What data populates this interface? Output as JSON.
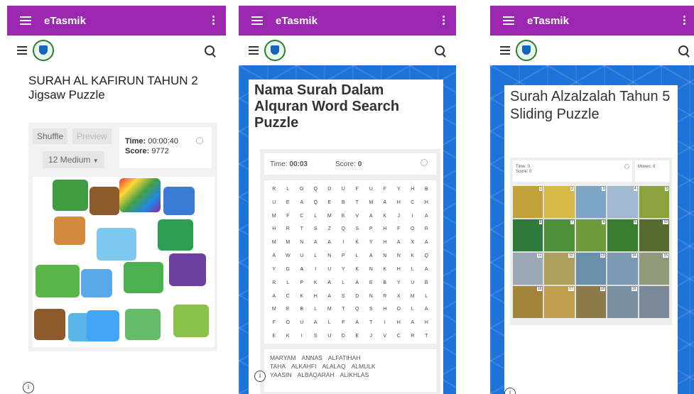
{
  "phones": [
    {
      "app_title": "eTasmik",
      "puzzle_title_line1": "SURAH AL KAFIRUN TAHUN 2",
      "puzzle_title_line2": "Jigsaw Puzzle",
      "shuffle_label": "Shuffle",
      "preview_label": "Preview",
      "difficulty_value": "12 Medium",
      "time_label": "Time:",
      "time_value": "00:00:40",
      "score_label": "Score:",
      "score_value": "9772"
    },
    {
      "app_title": "eTasmik",
      "puzzle_title": "Nama Surah Dalam Alquran Word Search Puzzle",
      "time_label": "Time:",
      "time_value": "00:03",
      "score_label": "Score:",
      "score_value": "0",
      "grid": [
        [
          "R",
          "L",
          "G",
          "Q",
          "D",
          "U",
          "F",
          "U",
          "F",
          "Y",
          "H",
          "B"
        ],
        [
          "U",
          "E",
          "A",
          "Q",
          "E",
          "B",
          "T",
          "M",
          "A",
          "H",
          "C",
          "H"
        ],
        [
          "M",
          "F",
          "C",
          "L",
          "M",
          "E",
          "V",
          "A",
          "K",
          "J",
          "I",
          "A"
        ],
        [
          "H",
          "R",
          "T",
          "S",
          "Z",
          "Q",
          "S",
          "P",
          "H",
          "F",
          "O",
          "R"
        ],
        [
          "M",
          "M",
          "N",
          "A",
          "A",
          "I",
          "K",
          "Y",
          "H",
          "A",
          "X",
          "A"
        ],
        [
          "A",
          "W",
          "U",
          "L",
          "N",
          "P",
          "L",
          "A",
          "N",
          "N",
          "K",
          "Q"
        ],
        [
          "Y",
          "G",
          "A",
          "I",
          "U",
          "Y",
          "K",
          "N",
          "K",
          "H",
          "L",
          "A"
        ],
        [
          "R",
          "L",
          "P",
          "K",
          "A",
          "L",
          "A",
          "E",
          "B",
          "Y",
          "U",
          "B"
        ],
        [
          "A",
          "C",
          "K",
          "H",
          "A",
          "S",
          "D",
          "N",
          "R",
          "X",
          "M",
          "L"
        ],
        [
          "M",
          "E",
          "B",
          "L",
          "M",
          "T",
          "Q",
          "S",
          "H",
          "O",
          "L",
          "A"
        ],
        [
          "F",
          "O",
          "U",
          "A",
          "L",
          "F",
          "A",
          "T",
          "I",
          "H",
          "A",
          "H"
        ],
        [
          "E",
          "K",
          "I",
          "S",
          "U",
          "D",
          "E",
          "J",
          "V",
          "C",
          "R",
          "T"
        ]
      ],
      "words": [
        "MARYAM",
        "ANNAS",
        "ALFATIHAH",
        "TAHA",
        "ALKAHFI",
        "ALALAQ",
        "ALMULK",
        "YAASIN",
        "ALBAQARAH",
        "ALIKHLAS"
      ]
    },
    {
      "app_title": "eTasmik",
      "puzzle_title": "Surah Alzalzalah Tahun 5 Sliding Puzzle",
      "time_label": "Time: 0",
      "score_label": "Score: 0",
      "moves_label": "Moves: 0",
      "tile_numbers": [
        "1",
        "2",
        "3",
        "4",
        "5",
        "6",
        "7",
        "8",
        "9",
        "10",
        "11",
        "12",
        "13",
        "14",
        "15",
        "16",
        "17",
        "18",
        "19",
        ""
      ]
    }
  ],
  "colors": {
    "appbar": "#9c27b0",
    "background_pattern": "#1e73d9"
  }
}
